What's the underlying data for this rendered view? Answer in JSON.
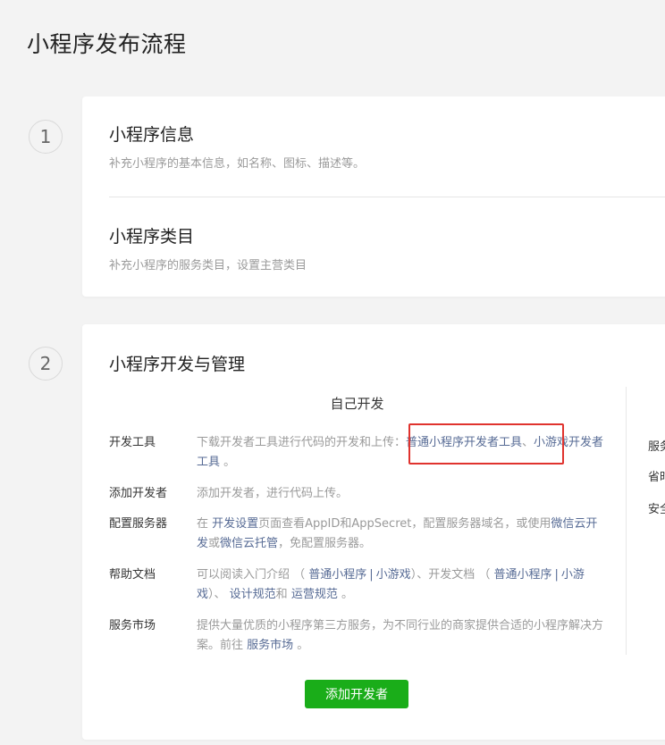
{
  "page": {
    "title": "小程序发布流程"
  },
  "steps": [
    "1",
    "2"
  ],
  "section1": {
    "info_title": "小程序信息",
    "info_desc": "补充小程序的基本信息，如名称、图标、描述等。",
    "category_title": "小程序类目",
    "category_desc": "补充小程序的服务类目，设置主营类目"
  },
  "section2": {
    "title": "小程序开发与管理",
    "self_dev_title": "自己开发",
    "rows": {
      "devtools": {
        "label": "开发工具",
        "text": "下载开发者工具进行代码的开发和上传：",
        "link1": "普通小程序开发者工具",
        "sep": "、",
        "link2": "小游戏开发者工具",
        "end": "。"
      },
      "add_dev": {
        "label": "添加开发者",
        "text": "添加开发者，进行代码上传。"
      },
      "server": {
        "label": "配置服务器",
        "t1": "在 ",
        "link1": "开发设置",
        "t2": "页面查看AppID和AppSecret，配置服务器域名，或使用",
        "link2": "微信云开发",
        "t3": "或",
        "link3": "微信云托管",
        "t4": "，免配置服务器。"
      },
      "docs": {
        "label": "帮助文档",
        "t1": "可以阅读入门介绍 （ ",
        "link1": "普通小程序",
        "pipe": "|",
        "link2": "小游戏",
        "t2": "）、开发文档 （ ",
        "link3": "普通小程序",
        "link4": "小游戏",
        "t3": "）、 ",
        "link5": "设计规范",
        "t4": "和 ",
        "link6": "运营规范",
        "t5": " 。"
      },
      "market": {
        "label": "服务市场",
        "t1": "提供大量优质的小程序第三方服务，为不同行业的商家提供合适的小程序解决方案。前往 ",
        "link1": "服务市场",
        "t2": " 。"
      }
    },
    "add_button": "添加开发者",
    "side_labels": [
      "服务",
      "省时",
      "安全"
    ]
  },
  "colors": {
    "link": "#576b95",
    "primary_button": "#1aad19",
    "highlight_box": "#e0332e"
  }
}
